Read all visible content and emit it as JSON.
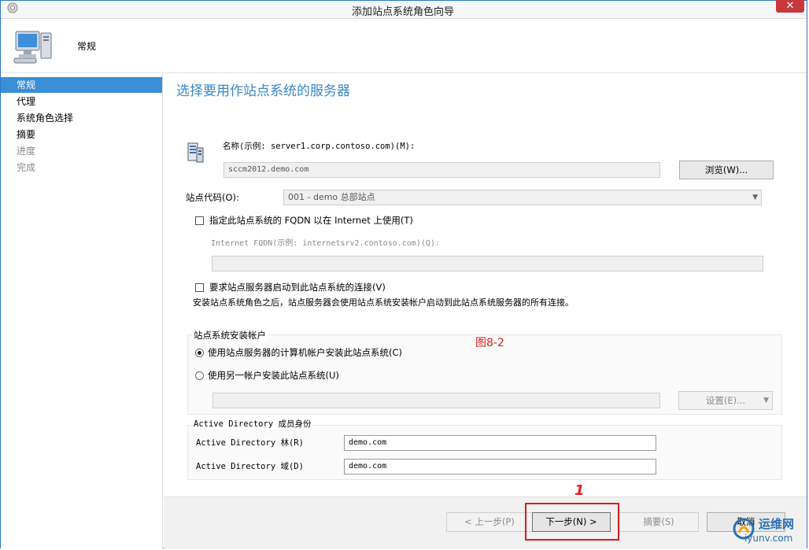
{
  "window": {
    "title": "添加站点系统角色向导",
    "close_glyph": "✕"
  },
  "header": {
    "title": "常规"
  },
  "sidebar": {
    "items": [
      {
        "label": "常规",
        "state": "active"
      },
      {
        "label": "代理",
        "state": "normal"
      },
      {
        "label": "系统角色选择",
        "state": "normal"
      },
      {
        "label": "摘要",
        "state": "normal"
      },
      {
        "label": "进度",
        "state": "disabled"
      },
      {
        "label": "完成",
        "state": "disabled"
      }
    ]
  },
  "main": {
    "title": "选择要用作站点系统的服务器",
    "name_label": "名称(示例: server1.corp.contoso.com)(M):",
    "name_value": "sccm2012.demo.com",
    "browse_button": "浏览(W)...",
    "site_code_label": "站点代码(O):",
    "site_code_value": "001 - demo 总部站点",
    "fqdn_checkbox_label": "指定此站点系统的 FQDN 以在 Internet 上使用(T)",
    "fqdn_checked": false,
    "internet_fqdn_label": "Internet FQDN(示例: internetsrv2.contoso.com)(Q):",
    "internet_fqdn_value": "",
    "require_checkbox_label": "要求站点服务器启动到此站点系统的连接(V)",
    "require_checked": false,
    "require_note": "安装站点系统角色之后，站点服务器会使用站点系统安装帐户启动到此站点系统服务器的所有连接。",
    "install_account": {
      "legend": "站点系统安装帐户",
      "radio_computer": "使用站点服务器的计算机帐户安装此站点系统(C)",
      "radio_other": "使用另一帐户安装此站点系统(U)",
      "selected": "computer",
      "account_value": "",
      "settings_button": "设置(E)..."
    },
    "ad": {
      "legend": "Active Directory 成员身份",
      "forest_label": "Active Directory 林(R)",
      "forest_value": "demo.com",
      "domain_label": "Active Directory 域(D)",
      "domain_value": "demo.com"
    }
  },
  "footer": {
    "prev_button": "< 上一步(P)",
    "next_button": "下一步(N) >",
    "summary_button": "摘要(S)",
    "cancel_button": "取消"
  },
  "annotations": {
    "figure_label": "图8-2",
    "step_mark": "1"
  },
  "watermark": {
    "line1": "运维网",
    "line2": "iyunv.com"
  },
  "colors": {
    "accent": "#3a8fd6",
    "annotation": "#e01a1a"
  }
}
